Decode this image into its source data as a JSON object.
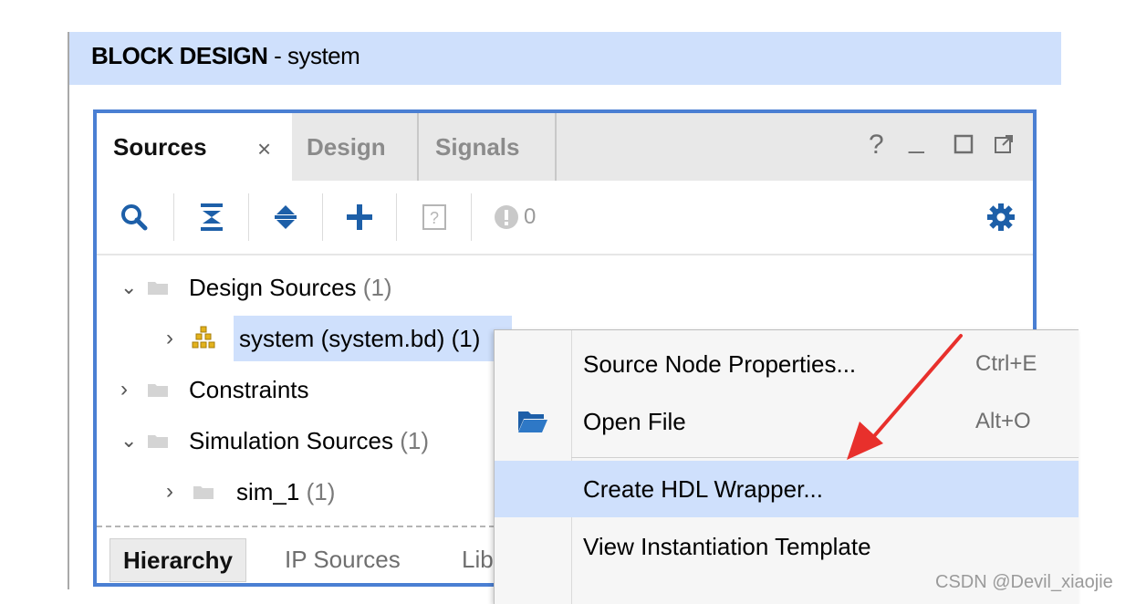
{
  "header": {
    "title_strong": "BLOCK DESIGN",
    "title_rest": " - system"
  },
  "tabs": {
    "sources": "Sources",
    "close": "×",
    "design": "Design",
    "signals": "Signals"
  },
  "window_controls": {
    "help": "?",
    "minimize": "_",
    "restore": "☐",
    "float": "⧉"
  },
  "toolbar": {
    "warning_count": "0",
    "icons": [
      "search-icon",
      "collapse-all-icon",
      "expand-all-icon",
      "add-icon",
      "help-doc-icon",
      "warning-icon",
      "gear-icon"
    ]
  },
  "tree": {
    "design_sources": {
      "label": "Design Sources",
      "count": "(1)"
    },
    "system": {
      "label": "system (system.bd) (1)"
    },
    "constraints": {
      "label": "Constraints"
    },
    "simulation_sources": {
      "label": "Simulation Sources",
      "count": "(1)"
    },
    "sim_1": {
      "label": "sim_1",
      "count": "(1)"
    }
  },
  "bottom_tabs": {
    "hierarchy": "Hierarchy",
    "ip_sources": "IP Sources",
    "libraries": "Lib"
  },
  "context_menu": {
    "items": [
      {
        "label": "Source Node Properties...",
        "shortcut": "Ctrl+E"
      },
      {
        "label": "Open File",
        "shortcut": "Alt+O"
      },
      {
        "label": "Create HDL Wrapper...",
        "shortcut": ""
      },
      {
        "label": "View Instantiation Template",
        "shortcut": ""
      }
    ]
  },
  "watermark": "CSDN @Devil_xiaojie",
  "colors": {
    "accent_border": "#4a7fd3",
    "selection": "#cfe0fc",
    "arrow": "#e8302c"
  }
}
